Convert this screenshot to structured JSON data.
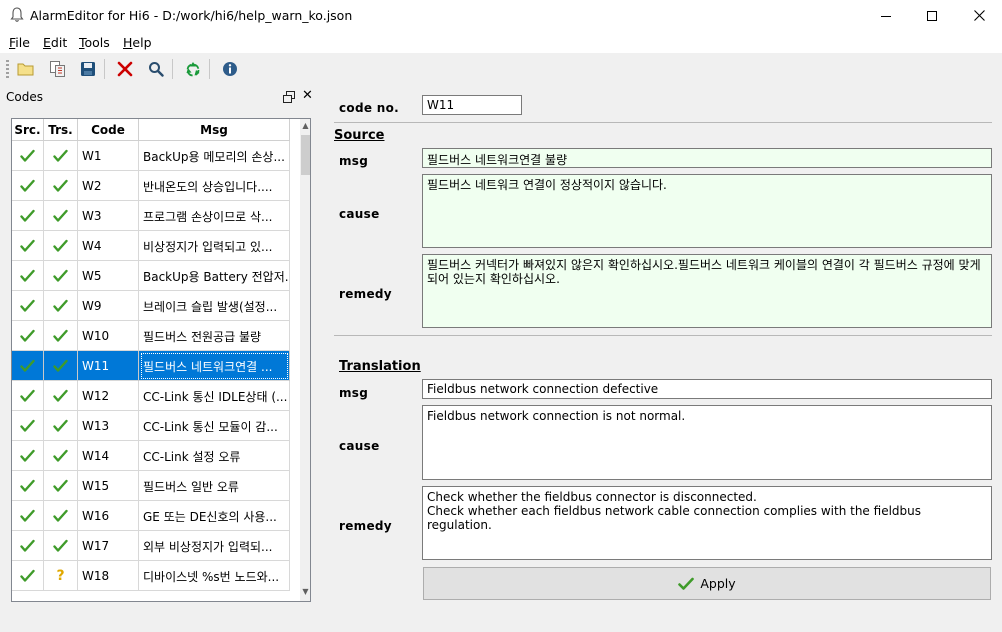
{
  "window": {
    "title": "AlarmEditor for Hi6 - D:/work/hi6/help_warn_ko.json"
  },
  "menu": [
    {
      "label": "File",
      "accel": "F",
      "rest": "ile"
    },
    {
      "label": "Edit",
      "accel": "E",
      "rest": "dit"
    },
    {
      "label": "Tools",
      "accel": "T",
      "rest": "ools"
    },
    {
      "label": "Help",
      "accel": "H",
      "rest": "elp"
    }
  ],
  "toolbar": {
    "icons": [
      "open-folder-icon",
      "copy-file-icon",
      "save-icon",
      "delete-icon",
      "search-icon",
      "recycle-icon",
      "info-icon"
    ],
    "colors": {
      "delete": "#cc0000",
      "recycle": "#1a9a3a",
      "info": "#2e5c8a",
      "save": "#1f4f7a"
    }
  },
  "codes_panel": {
    "title": "Codes",
    "columns": [
      "Src.",
      "Trs.",
      "Code",
      "Msg"
    ],
    "selected_index": 7,
    "rows": [
      {
        "src": "check",
        "trs": "check",
        "code": "W1",
        "msg": "BackUp용 메모리의 손상..."
      },
      {
        "src": "check",
        "trs": "check",
        "code": "W2",
        "msg": "반내온도의 상승입니다...."
      },
      {
        "src": "check",
        "trs": "check",
        "code": "W3",
        "msg": "프로그램 손상이므로 삭..."
      },
      {
        "src": "check",
        "trs": "check",
        "code": "W4",
        "msg": "비상정지가 입력되고 있..."
      },
      {
        "src": "check",
        "trs": "check",
        "code": "W5",
        "msg": "BackUp용 Battery 전압저..."
      },
      {
        "src": "check",
        "trs": "check",
        "code": "W9",
        "msg": "브레이크 슬립 발생(설정..."
      },
      {
        "src": "check",
        "trs": "check",
        "code": "W10",
        "msg": "필드버스 전원공급 불량"
      },
      {
        "src": "check",
        "trs": "check",
        "code": "W11",
        "msg": "필드버스 네트워크연결 ..."
      },
      {
        "src": "check",
        "trs": "check",
        "code": "W12",
        "msg": "CC-Link 통신 IDLE상태 (..."
      },
      {
        "src": "check",
        "trs": "check",
        "code": "W13",
        "msg": "CC-Link 통신 모듈이 감..."
      },
      {
        "src": "check",
        "trs": "check",
        "code": "W14",
        "msg": "CC-Link 설정 오류"
      },
      {
        "src": "check",
        "trs": "check",
        "code": "W15",
        "msg": "필드버스 일반 오류"
      },
      {
        "src": "check",
        "trs": "check",
        "code": "W16",
        "msg": "GE 또는 DE신호의 사용..."
      },
      {
        "src": "check",
        "trs": "check",
        "code": "W17",
        "msg": "외부 비상정지가 입력되..."
      },
      {
        "src": "check",
        "trs": "question",
        "code": "W18",
        "msg": "디바이스넷 %s번 노드와..."
      }
    ]
  },
  "editor": {
    "code_label": "code no.",
    "code_value": "W11",
    "source": {
      "heading": "Source",
      "msg_label": "msg",
      "msg_value": "필드버스 네트워크연결 불량",
      "cause_label": "cause",
      "cause_value": "필드버스 네트워크 연결이 정상적이지 않습니다.",
      "remedy_label": "remedy",
      "remedy_value": "필드버스 커넥터가 빠져있지 않은지 확인하십시오.필드버스 네트워크 케이블의 연결이 각 필드버스 규정에 맞게 되어 있는지 확인하십시오."
    },
    "translation": {
      "heading": "Translation",
      "msg_label": "msg",
      "msg_value": "Fieldbus network connection defective",
      "cause_label": "cause",
      "cause_value": "Fieldbus network connection is not normal.",
      "remedy_label": "remedy",
      "remedy_value": "Check whether the fieldbus connector is disconnected.\nCheck whether each fieldbus network cable connection complies with the fieldbus regulation."
    },
    "apply_label": "Apply"
  }
}
